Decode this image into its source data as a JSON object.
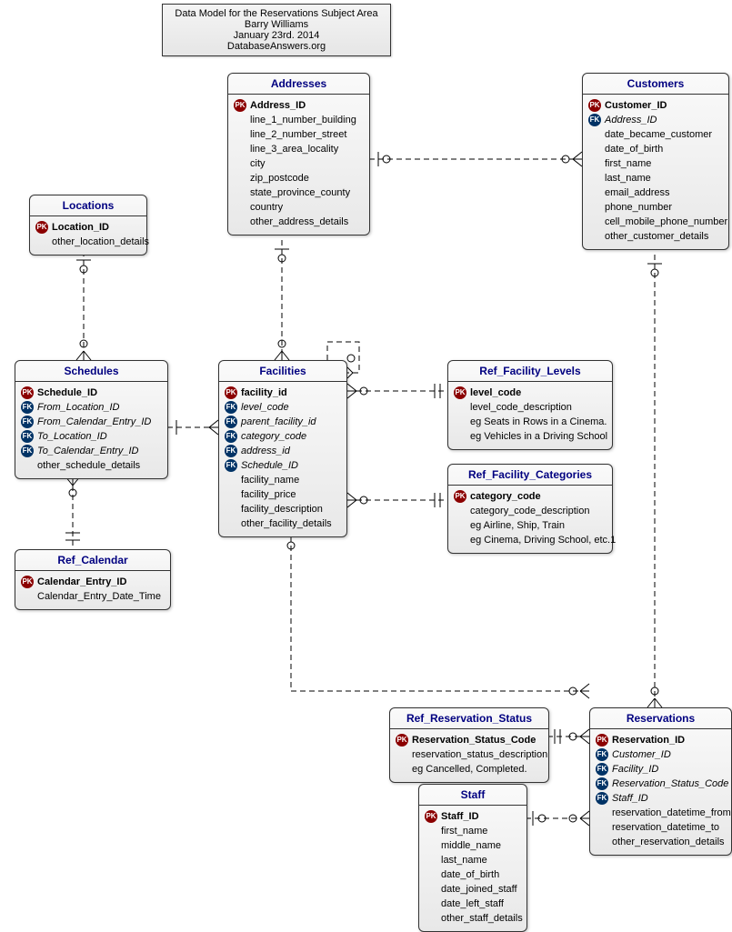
{
  "note": {
    "line1": "Data Model for the Reservations Subject Area",
    "line2": "Barry Williams",
    "line3": "January 23rd. 2014",
    "line4": "DatabaseAnswers.org"
  },
  "entities": {
    "addresses": {
      "title": "Addresses",
      "attrs": [
        {
          "key": "pk",
          "text": "Address_ID",
          "bold": true
        },
        {
          "key": "",
          "text": "line_1_number_building"
        },
        {
          "key": "",
          "text": "line_2_number_street"
        },
        {
          "key": "",
          "text": "line_3_area_locality"
        },
        {
          "key": "",
          "text": "city"
        },
        {
          "key": "",
          "text": "zip_postcode"
        },
        {
          "key": "",
          "text": "state_province_county"
        },
        {
          "key": "",
          "text": "country"
        },
        {
          "key": "",
          "text": "other_address_details"
        }
      ]
    },
    "customers": {
      "title": "Customers",
      "attrs": [
        {
          "key": "pk",
          "text": "Customer_ID",
          "bold": true
        },
        {
          "key": "fk",
          "text": "Address_ID",
          "italic": true
        },
        {
          "key": "",
          "text": "date_became_customer"
        },
        {
          "key": "",
          "text": "date_of_birth"
        },
        {
          "key": "",
          "text": "first_name"
        },
        {
          "key": "",
          "text": "last_name"
        },
        {
          "key": "",
          "text": "email_address"
        },
        {
          "key": "",
          "text": "phone_number"
        },
        {
          "key": "",
          "text": "cell_mobile_phone_number"
        },
        {
          "key": "",
          "text": "other_customer_details"
        }
      ]
    },
    "locations": {
      "title": "Locations",
      "attrs": [
        {
          "key": "pk",
          "text": "Location_ID",
          "bold": true
        },
        {
          "key": "",
          "text": "other_location_details"
        }
      ]
    },
    "schedules": {
      "title": "Schedules",
      "attrs": [
        {
          "key": "pk",
          "text": "Schedule_ID",
          "bold": true
        },
        {
          "key": "fk",
          "text": "From_Location_ID",
          "italic": true
        },
        {
          "key": "fk",
          "text": "From_Calendar_Entry_ID",
          "italic": true
        },
        {
          "key": "fk",
          "text": "To_Location_ID",
          "italic": true
        },
        {
          "key": "fk",
          "text": "To_Calendar_Entry_ID",
          "italic": true
        },
        {
          "key": "",
          "text": "other_schedule_details"
        }
      ]
    },
    "facilities": {
      "title": "Facilities",
      "attrs": [
        {
          "key": "pk",
          "text": "facility_id",
          "bold": true
        },
        {
          "key": "fk",
          "text": "level_code",
          "italic": true
        },
        {
          "key": "fk",
          "text": "parent_facility_id",
          "italic": true
        },
        {
          "key": "fk",
          "text": "category_code",
          "italic": true
        },
        {
          "key": "fk",
          "text": "address_id",
          "italic": true
        },
        {
          "key": "fk",
          "text": "Schedule_ID",
          "italic": true
        },
        {
          "key": "",
          "text": "facility_name"
        },
        {
          "key": "",
          "text": "facility_price"
        },
        {
          "key": "",
          "text": "facility_description"
        },
        {
          "key": "",
          "text": "other_facility_details"
        }
      ]
    },
    "ref_facility_levels": {
      "title": "Ref_Facility_Levels",
      "attrs": [
        {
          "key": "pk",
          "text": "level_code",
          "bold": true
        },
        {
          "key": "",
          "text": "level_code_description"
        },
        {
          "key": "",
          "text": "eg Seats in Rows in a Cinema."
        },
        {
          "key": "",
          "text": "eg Vehicles in a Driving School"
        }
      ]
    },
    "ref_facility_categories": {
      "title": "Ref_Facility_Categories",
      "attrs": [
        {
          "key": "pk",
          "text": "category_code",
          "bold": true
        },
        {
          "key": "",
          "text": "category_code_description"
        },
        {
          "key": "",
          "text": "eg Airline, Ship, Train"
        },
        {
          "key": "",
          "text": "eg Cinema, Driving School, etc.1"
        }
      ]
    },
    "ref_calendar": {
      "title": "Ref_Calendar",
      "attrs": [
        {
          "key": "pk",
          "text": "Calendar_Entry_ID",
          "bold": true
        },
        {
          "key": "",
          "text": "Calendar_Entry_Date_Time"
        }
      ]
    },
    "ref_reservation_status": {
      "title": "Ref_Reservation_Status",
      "attrs": [
        {
          "key": "pk",
          "text": "Reservation_Status_Code",
          "bold": true
        },
        {
          "key": "",
          "text": "reservation_status_description"
        },
        {
          "key": "",
          "text": "eg Cancelled, Completed."
        }
      ]
    },
    "staff": {
      "title": "Staff",
      "attrs": [
        {
          "key": "pk",
          "text": "Staff_ID",
          "bold": true
        },
        {
          "key": "",
          "text": "first_name"
        },
        {
          "key": "",
          "text": "middle_name"
        },
        {
          "key": "",
          "text": "last_name"
        },
        {
          "key": "",
          "text": "date_of_birth"
        },
        {
          "key": "",
          "text": "date_joined_staff"
        },
        {
          "key": "",
          "text": "date_left_staff"
        },
        {
          "key": "",
          "text": "other_staff_details"
        }
      ]
    },
    "reservations": {
      "title": "Reservations",
      "attrs": [
        {
          "key": "pk",
          "text": "Reservation_ID",
          "bold": true
        },
        {
          "key": "fk",
          "text": "Customer_ID",
          "italic": true
        },
        {
          "key": "fk",
          "text": "Facility_ID",
          "italic": true
        },
        {
          "key": "fk",
          "text": "Reservation_Status_Code",
          "italic": true
        },
        {
          "key": "fk",
          "text": "Staff_ID",
          "italic": true
        },
        {
          "key": "",
          "text": "reservation_datetime_from"
        },
        {
          "key": "",
          "text": "reservation_datetime_to"
        },
        {
          "key": "",
          "text": "other_reservation_details"
        }
      ]
    }
  }
}
